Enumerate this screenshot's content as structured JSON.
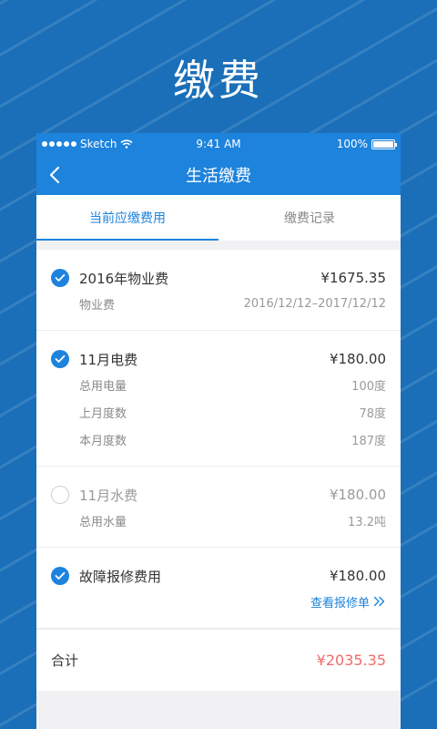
{
  "hero": {
    "title": "缴费"
  },
  "status_bar": {
    "carrier": "Sketch",
    "time": "9:41 AM",
    "battery": "100%"
  },
  "nav": {
    "title": "生活缴费"
  },
  "tabs": [
    {
      "label": "当前应缴费用",
      "active": true
    },
    {
      "label": "缴费记录",
      "active": false
    }
  ],
  "bills": [
    {
      "name": "2016年物业费",
      "amount": "¥1675.35",
      "checked": true,
      "details": [
        {
          "label": "物业费",
          "value": "2016/12/12–2017/12/12"
        }
      ]
    },
    {
      "name": "11月电费",
      "amount": "¥180.00",
      "checked": true,
      "details": [
        {
          "label": "总用电量",
          "value": "100度"
        },
        {
          "label": "上月度数",
          "value": "78度"
        },
        {
          "label": "本月度数",
          "value": "187度"
        }
      ]
    },
    {
      "name": "11月水费",
      "amount": "¥180.00",
      "checked": false,
      "details": [
        {
          "label": "总用水量",
          "value": "13.2吨"
        }
      ]
    },
    {
      "name": "故障报修费用",
      "amount": "¥180.00",
      "checked": true,
      "link": "查看报修单"
    }
  ],
  "total": {
    "label": "合计",
    "value": "¥2035.35"
  },
  "colors": {
    "accent": "#1d83dc",
    "total": "#f06b6b",
    "background": "#1a6fb8"
  }
}
